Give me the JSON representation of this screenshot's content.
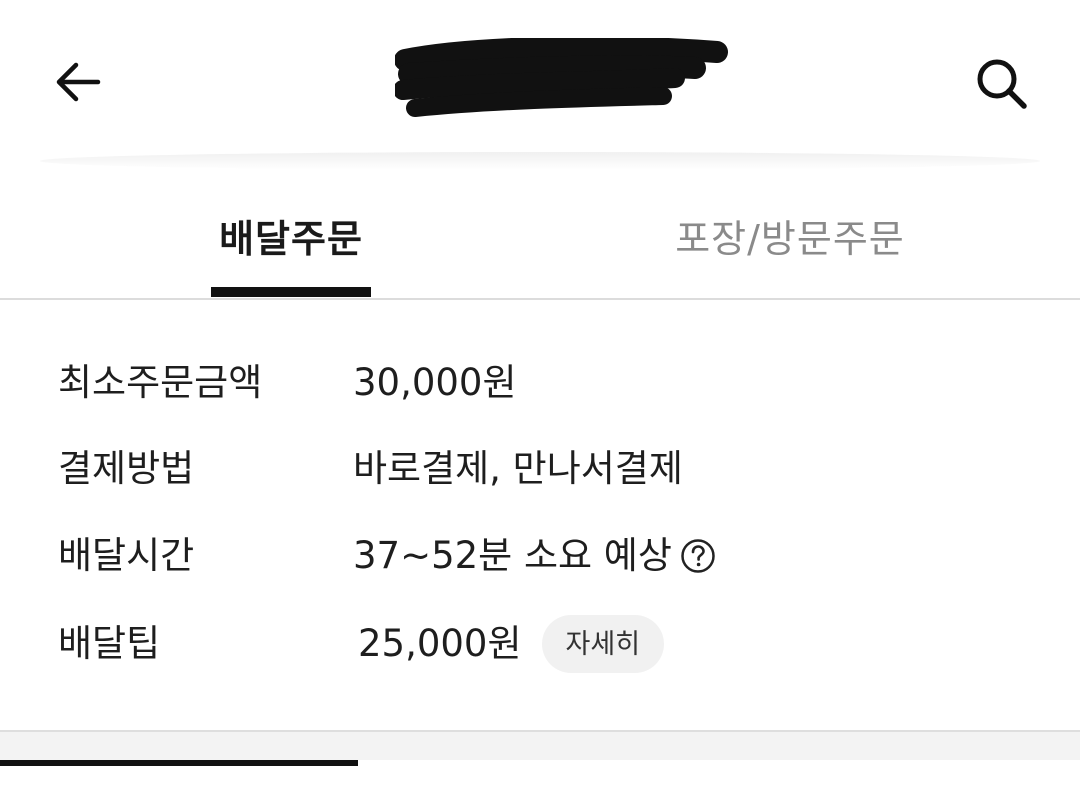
{
  "header": {
    "back_icon": "arrow-left-icon",
    "search_icon": "search-icon",
    "title": ""
  },
  "tabs": [
    {
      "label": "배달주문",
      "active": true
    },
    {
      "label": "포장/방문주문",
      "active": false
    }
  ],
  "info": {
    "min_order": {
      "label": "최소주문금액",
      "value": "30,000원"
    },
    "payment": {
      "label": "결제방법",
      "value": "바로결제, 만나서결제"
    },
    "delivery_time": {
      "label": "배달시간",
      "value": "37~52분 소요 예상",
      "help_icon": "question-circle-icon"
    },
    "delivery_tip": {
      "label": "배달팁",
      "value": "25,000원",
      "detail_button": "자세히"
    }
  },
  "colors": {
    "active_tab": "#111111",
    "inactive_tab": "#8a8a8a",
    "detail_button_bg": "#f1f1f1"
  }
}
